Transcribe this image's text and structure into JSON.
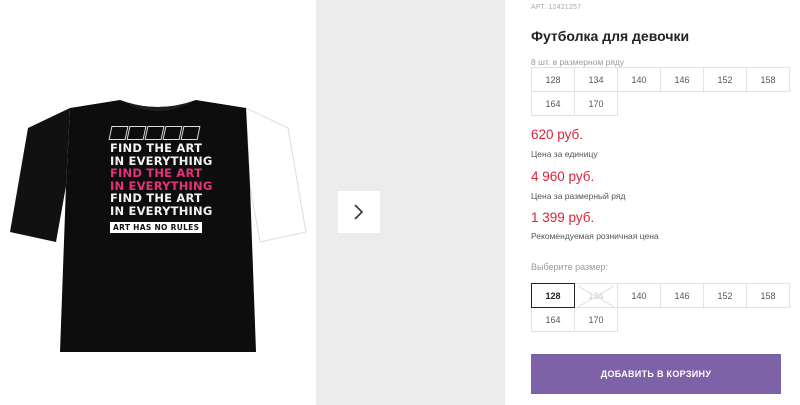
{
  "product": {
    "sku": "АРТ. 12421257",
    "title": "Футболка для девочки"
  },
  "size_row": {
    "label": "8 шт. в размерном ряду",
    "sizes": [
      "128",
      "134",
      "140",
      "146",
      "152",
      "158",
      "164",
      "170"
    ]
  },
  "prices": {
    "unit_price": "620 руб.",
    "unit_note": "Цена за единицу",
    "row_price": "4 960 руб.",
    "row_note": "Цена за размерный ряд",
    "retail_price": "1 399 руб.",
    "retail_note": "Рекомендуемая розничная цена"
  },
  "size_picker": {
    "label": "Выберите размер:",
    "selected": "128",
    "options": [
      {
        "size": "128",
        "state": "selected"
      },
      {
        "size": "134",
        "state": "disabled"
      },
      {
        "size": "140",
        "state": "available"
      },
      {
        "size": "146",
        "state": "available"
      },
      {
        "size": "152",
        "state": "available"
      },
      {
        "size": "158",
        "state": "available"
      },
      {
        "size": "164",
        "state": "available"
      },
      {
        "size": "170",
        "state": "available"
      }
    ]
  },
  "cart": {
    "label": "ДОБАВИТЬ В КОРЗИНУ"
  },
  "gallery": {
    "next_icon": "chevron-right-icon",
    "print_lines": [
      "FIND THE ART",
      "IN EVERYTHING",
      "FIND THE ART",
      "IN EVERYTHING",
      "FIND THE ART",
      "IN EVERYTHING"
    ],
    "print_tagline": "ART HAS NO RULES"
  },
  "colors": {
    "accent_button": "#7e62a8",
    "price": "#d8243a",
    "print_pink": "#e8307d"
  }
}
